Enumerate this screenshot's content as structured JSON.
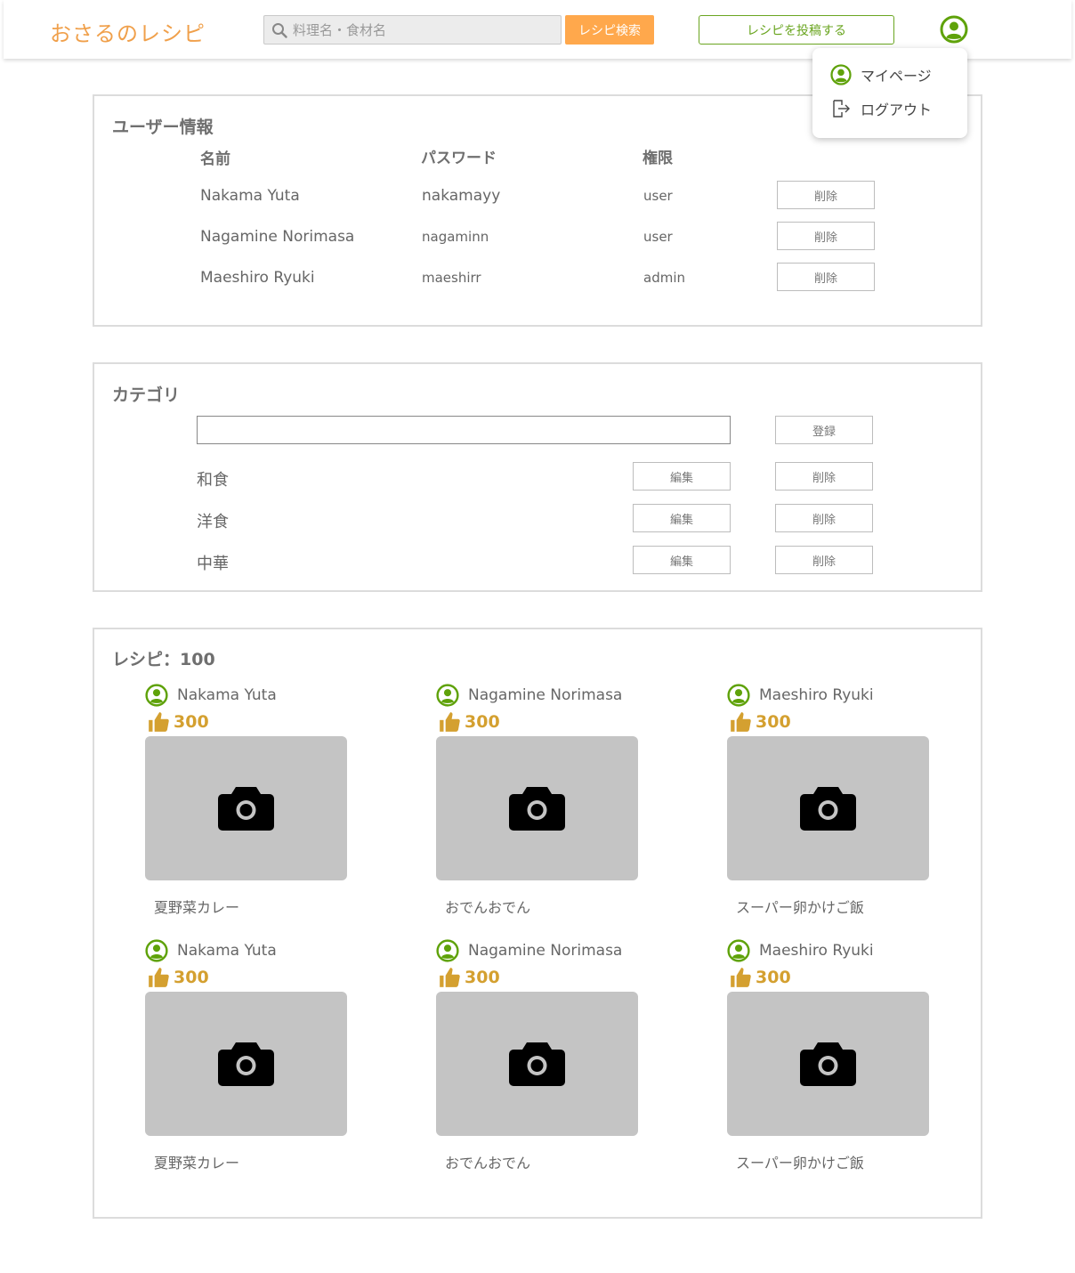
{
  "header": {
    "logo": "おさるのレシピ",
    "search_placeholder": "料理名・食材名",
    "search_button": "レシピ検索",
    "post_button": "レシピを投稿する"
  },
  "dropdown": {
    "items": [
      {
        "label": "マイページ",
        "icon": "user-icon"
      },
      {
        "label": "ログアウト",
        "icon": "logout-icon"
      }
    ]
  },
  "users": {
    "title": "ユーザー情報",
    "headers": [
      "名前",
      "パスワード",
      "権限"
    ],
    "rows": [
      {
        "name": "Nakama Yuta",
        "password": "nakamayy",
        "role": "user",
        "action": "削除"
      },
      {
        "name": "Nagamine Norimasa",
        "password": "nagaminn",
        "role": "user",
        "action": "削除"
      },
      {
        "name": "Maeshiro Ryuki",
        "password": "maeshirr",
        "role": "admin",
        "action": "削除"
      }
    ]
  },
  "categories": {
    "title": "カテゴリ",
    "register_button": "登録",
    "items": [
      {
        "name": "和食",
        "edit": "編集",
        "delete": "削除"
      },
      {
        "name": "洋食",
        "edit": "編集",
        "delete": "削除"
      },
      {
        "name": "中華",
        "edit": "編集",
        "delete": "削除"
      }
    ]
  },
  "recipes": {
    "title": "レシピ：100",
    "cards": [
      {
        "user": "Nakama Yuta",
        "likes": "300",
        "title": "夏野菜カレー"
      },
      {
        "user": "Nagamine Norimasa",
        "likes": "300",
        "title": "おでんおでん"
      },
      {
        "user": "Maeshiro Ryuki",
        "likes": "300",
        "title": "スーパー卵かけご飯"
      },
      {
        "user": "Nakama Yuta",
        "likes": "300",
        "title": "夏野菜カレー"
      },
      {
        "user": "Nagamine Norimasa",
        "likes": "300",
        "title": "おでんおでん"
      },
      {
        "user": "Maeshiro Ryuki",
        "likes": "300",
        "title": "スーパー卵かけご飯"
      }
    ]
  },
  "colors": {
    "brand": "#f0a04b",
    "accent_green": "#6aa520",
    "likes": "#d4a030",
    "placeholder_image": "#c4c4c4"
  }
}
